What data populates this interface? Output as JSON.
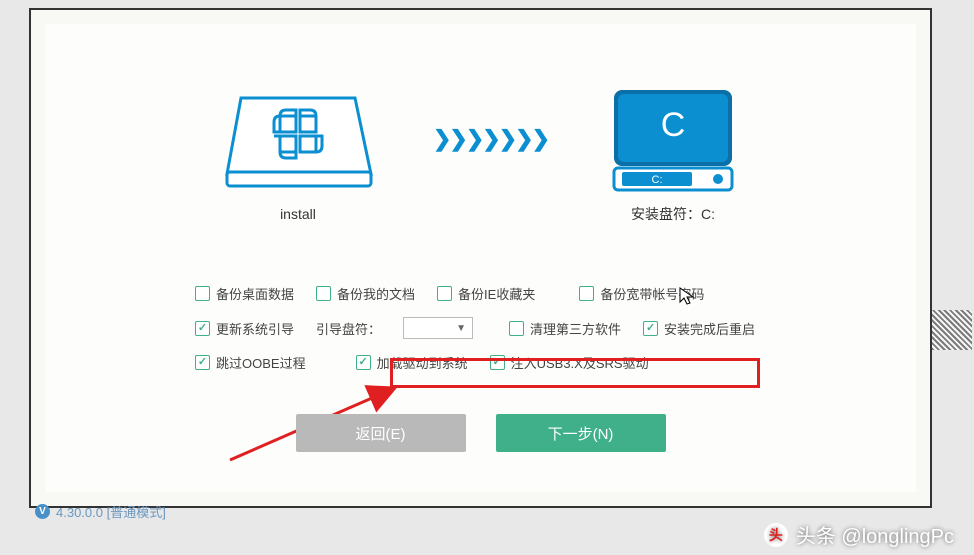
{
  "install_label": "install",
  "target_label": "安装盘符：C:",
  "drive_letter_big": "C",
  "drive_letter_small": "C:",
  "options": {
    "backup_desktop": "备份桌面数据",
    "backup_docs": "备份我的文档",
    "backup_ie": "备份IE收藏夹",
    "backup_broadband": "备份宽带帐号密码",
    "update_boot": "更新系统引导",
    "boot_drive_label": "引导盘符：",
    "clean_third": "清理第三方软件",
    "restart_after": "安装完成后重启",
    "skip_oobe": "跳过OOBE过程",
    "load_drivers": "加载驱动到系统",
    "inject_usb3": "注入USB3.X及SRS驱动"
  },
  "buttons": {
    "back": "返回(E)",
    "next": "下一步(N)"
  },
  "footer": {
    "version": "4.30.0.0 [普通模式]"
  },
  "watermark": "头条 @longlingPc"
}
